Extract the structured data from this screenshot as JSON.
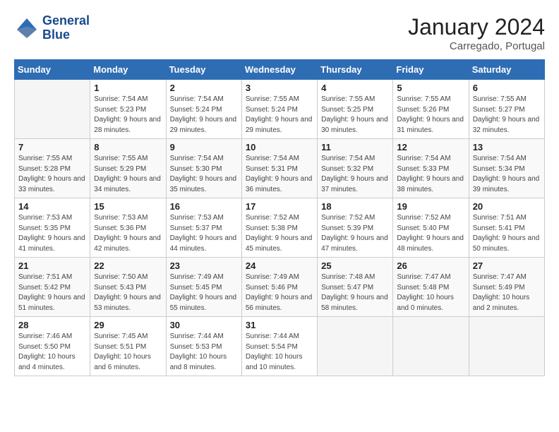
{
  "header": {
    "logo_line1": "General",
    "logo_line2": "Blue",
    "month": "January 2024",
    "location": "Carregado, Portugal"
  },
  "weekdays": [
    "Sunday",
    "Monday",
    "Tuesday",
    "Wednesday",
    "Thursday",
    "Friday",
    "Saturday"
  ],
  "weeks": [
    [
      {
        "day": "",
        "empty": true
      },
      {
        "day": "1",
        "sunrise": "7:54 AM",
        "sunset": "5:23 PM",
        "daylight": "9 hours and 28 minutes."
      },
      {
        "day": "2",
        "sunrise": "7:54 AM",
        "sunset": "5:24 PM",
        "daylight": "9 hours and 29 minutes."
      },
      {
        "day": "3",
        "sunrise": "7:55 AM",
        "sunset": "5:24 PM",
        "daylight": "9 hours and 29 minutes."
      },
      {
        "day": "4",
        "sunrise": "7:55 AM",
        "sunset": "5:25 PM",
        "daylight": "9 hours and 30 minutes."
      },
      {
        "day": "5",
        "sunrise": "7:55 AM",
        "sunset": "5:26 PM",
        "daylight": "9 hours and 31 minutes."
      },
      {
        "day": "6",
        "sunrise": "7:55 AM",
        "sunset": "5:27 PM",
        "daylight": "9 hours and 32 minutes."
      }
    ],
    [
      {
        "day": "7",
        "sunrise": "7:55 AM",
        "sunset": "5:28 PM",
        "daylight": "9 hours and 33 minutes."
      },
      {
        "day": "8",
        "sunrise": "7:55 AM",
        "sunset": "5:29 PM",
        "daylight": "9 hours and 34 minutes."
      },
      {
        "day": "9",
        "sunrise": "7:54 AM",
        "sunset": "5:30 PM",
        "daylight": "9 hours and 35 minutes."
      },
      {
        "day": "10",
        "sunrise": "7:54 AM",
        "sunset": "5:31 PM",
        "daylight": "9 hours and 36 minutes."
      },
      {
        "day": "11",
        "sunrise": "7:54 AM",
        "sunset": "5:32 PM",
        "daylight": "9 hours and 37 minutes."
      },
      {
        "day": "12",
        "sunrise": "7:54 AM",
        "sunset": "5:33 PM",
        "daylight": "9 hours and 38 minutes."
      },
      {
        "day": "13",
        "sunrise": "7:54 AM",
        "sunset": "5:34 PM",
        "daylight": "9 hours and 39 minutes."
      }
    ],
    [
      {
        "day": "14",
        "sunrise": "7:53 AM",
        "sunset": "5:35 PM",
        "daylight": "9 hours and 41 minutes."
      },
      {
        "day": "15",
        "sunrise": "7:53 AM",
        "sunset": "5:36 PM",
        "daylight": "9 hours and 42 minutes."
      },
      {
        "day": "16",
        "sunrise": "7:53 AM",
        "sunset": "5:37 PM",
        "daylight": "9 hours and 44 minutes."
      },
      {
        "day": "17",
        "sunrise": "7:52 AM",
        "sunset": "5:38 PM",
        "daylight": "9 hours and 45 minutes."
      },
      {
        "day": "18",
        "sunrise": "7:52 AM",
        "sunset": "5:39 PM",
        "daylight": "9 hours and 47 minutes."
      },
      {
        "day": "19",
        "sunrise": "7:52 AM",
        "sunset": "5:40 PM",
        "daylight": "9 hours and 48 minutes."
      },
      {
        "day": "20",
        "sunrise": "7:51 AM",
        "sunset": "5:41 PM",
        "daylight": "9 hours and 50 minutes."
      }
    ],
    [
      {
        "day": "21",
        "sunrise": "7:51 AM",
        "sunset": "5:42 PM",
        "daylight": "9 hours and 51 minutes."
      },
      {
        "day": "22",
        "sunrise": "7:50 AM",
        "sunset": "5:43 PM",
        "daylight": "9 hours and 53 minutes."
      },
      {
        "day": "23",
        "sunrise": "7:49 AM",
        "sunset": "5:45 PM",
        "daylight": "9 hours and 55 minutes."
      },
      {
        "day": "24",
        "sunrise": "7:49 AM",
        "sunset": "5:46 PM",
        "daylight": "9 hours and 56 minutes."
      },
      {
        "day": "25",
        "sunrise": "7:48 AM",
        "sunset": "5:47 PM",
        "daylight": "9 hours and 58 minutes."
      },
      {
        "day": "26",
        "sunrise": "7:47 AM",
        "sunset": "5:48 PM",
        "daylight": "10 hours and 0 minutes."
      },
      {
        "day": "27",
        "sunrise": "7:47 AM",
        "sunset": "5:49 PM",
        "daylight": "10 hours and 2 minutes."
      }
    ],
    [
      {
        "day": "28",
        "sunrise": "7:46 AM",
        "sunset": "5:50 PM",
        "daylight": "10 hours and 4 minutes."
      },
      {
        "day": "29",
        "sunrise": "7:45 AM",
        "sunset": "5:51 PM",
        "daylight": "10 hours and 6 minutes."
      },
      {
        "day": "30",
        "sunrise": "7:44 AM",
        "sunset": "5:53 PM",
        "daylight": "10 hours and 8 minutes."
      },
      {
        "day": "31",
        "sunrise": "7:44 AM",
        "sunset": "5:54 PM",
        "daylight": "10 hours and 10 minutes."
      },
      {
        "day": "",
        "empty": true
      },
      {
        "day": "",
        "empty": true
      },
      {
        "day": "",
        "empty": true
      }
    ]
  ]
}
